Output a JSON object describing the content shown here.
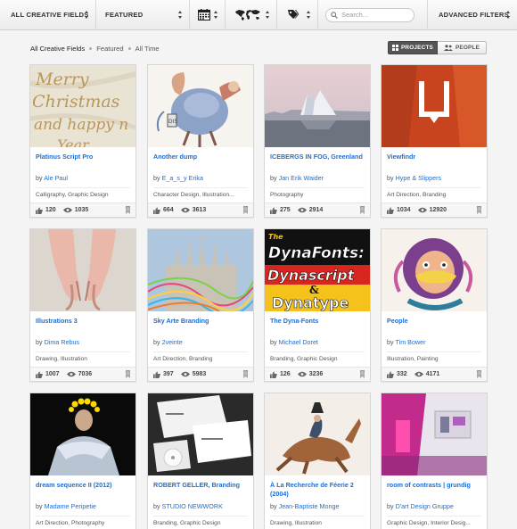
{
  "filters": {
    "fields": "ALL CREATIVE FIELDS",
    "sort": "FEATURED",
    "search_placeholder": "Search...",
    "advanced": "ADVANCED FILTERS"
  },
  "breadcrumb": [
    "All Creative Fields",
    "Featured",
    "All Time"
  ],
  "toggle": {
    "projects": "PROJECTS",
    "people": "PEOPLE"
  },
  "projects": [
    {
      "title": "Platinus Script Pro",
      "by": "by",
      "author": "Ale Paul",
      "fields": "Calligraphy, Graphic Design",
      "likes": "120",
      "views": "1035",
      "thumb_text": "Merry Christmas and happy n"
    },
    {
      "title": "Another dump",
      "by": "by",
      "author": "E_a_s_y Erika",
      "fields": "Character Design, Illustration...",
      "likes": "664",
      "views": "3613"
    },
    {
      "title": "ICEBERGS IN FOG, Greenland",
      "by": "by",
      "author": "Jan Erik Waider",
      "fields": "Photography",
      "likes": "275",
      "views": "2914"
    },
    {
      "title": "Viewfindr",
      "by": "by",
      "author": "Hype & Slippers",
      "fields": "Art Direction, Branding",
      "likes": "1034",
      "views": "12920"
    },
    {
      "title": "Illustrations 3",
      "by": "by",
      "author": "Dima Rebus",
      "fields": "Drawing, Illustration",
      "likes": "1007",
      "views": "7036"
    },
    {
      "title": "Sky Arte Branding",
      "by": "by",
      "author": "2veinte",
      "fields": "Art Direction, Branding",
      "likes": "397",
      "views": "5983"
    },
    {
      "title": "The Dyna-Fonts",
      "by": "by",
      "author": "Michael Doret",
      "fields": "Branding, Graphic Design",
      "likes": "126",
      "views": "3236",
      "thumb_text": [
        "The",
        "DynaFonts:",
        "Dynascript",
        "&",
        "Dynatype"
      ]
    },
    {
      "title": "People",
      "by": "by",
      "author": "Tim Bower",
      "fields": "Illustration, Painting",
      "likes": "332",
      "views": "4171"
    },
    {
      "title": "dream sequence II (2012)",
      "by": "by",
      "author": "Madame Peripetie",
      "fields": "Art Direction, Photography",
      "likes": "",
      "views": ""
    },
    {
      "title": "ROBERT GELLER, Branding",
      "by": "by",
      "author": "STUDIO NEWWORK",
      "fields": "Branding, Graphic Design",
      "likes": "",
      "views": ""
    },
    {
      "title": "À La Recherche de Féerie 2 (2004)",
      "by": "by",
      "author": "Jean-Baptiste Monge",
      "fields": "Drawing, Illustration",
      "likes": "",
      "views": ""
    },
    {
      "title": "room of contrasts | grundig",
      "by": "by",
      "author": "D'art Design Gruppe",
      "fields": "Graphic Design, Interior Desig...",
      "likes": "",
      "views": ""
    }
  ],
  "colors": {
    "link": "#1a6fd6",
    "background": "#f4f4f4"
  }
}
